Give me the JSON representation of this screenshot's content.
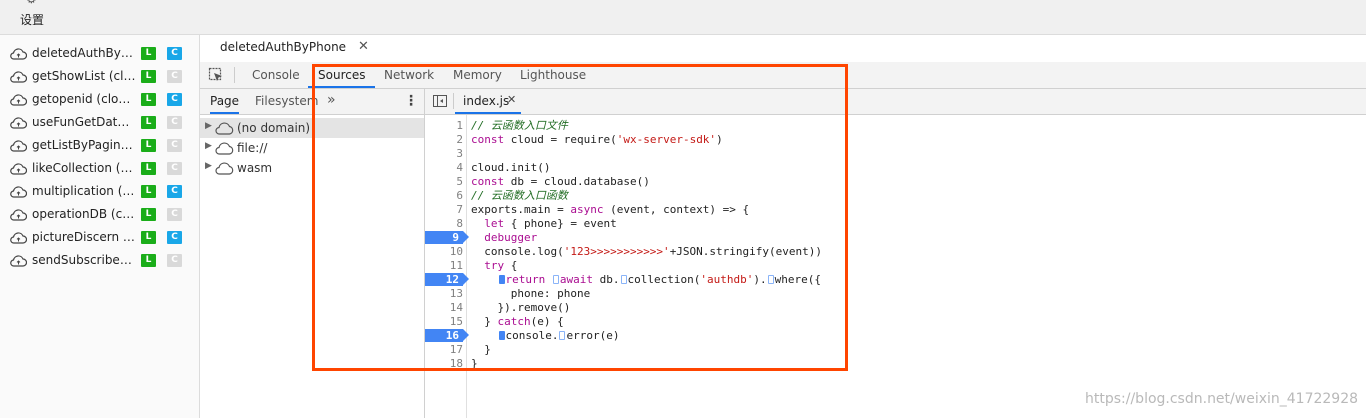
{
  "toolbar": {
    "settings_label": "设置",
    "settings_icon": "gear-icon"
  },
  "cloud_functions": [
    {
      "label": "deletedAuthByP...",
      "l_badge": "L",
      "c_badge": "C",
      "c_active": true
    },
    {
      "label": "getShowList (clo...",
      "l_badge": "L",
      "c_badge": "C",
      "c_active": false
    },
    {
      "label": "getopenid (cloud...",
      "l_badge": "L",
      "c_badge": "C",
      "c_active": true
    },
    {
      "label": "useFunGetData ...",
      "l_badge": "L",
      "c_badge": "C",
      "c_active": false
    },
    {
      "label": "getListByPaging ...",
      "l_badge": "L",
      "c_badge": "C",
      "c_active": false
    },
    {
      "label": "likeCollection (cl...",
      "l_badge": "L",
      "c_badge": "C",
      "c_active": false
    },
    {
      "label": "multiplication (cl...",
      "l_badge": "L",
      "c_badge": "C",
      "c_active": true
    },
    {
      "label": "operationDB (clo...",
      "l_badge": "L",
      "c_badge": "C",
      "c_active": false
    },
    {
      "label": "pictureDiscern (c...",
      "l_badge": "L",
      "c_badge": "C",
      "c_active": true
    },
    {
      "label": "sendSubscribeM...",
      "l_badge": "L",
      "c_badge": "C",
      "c_active": false
    }
  ],
  "file_tab": {
    "label": "deletedAuthByPhone",
    "close": "✕"
  },
  "devtools": {
    "tabs": [
      "Console",
      "Sources",
      "Network",
      "Memory",
      "Lighthouse"
    ],
    "active_tab": "Sources"
  },
  "navigator": {
    "tabs": [
      "Page",
      "Filesystem"
    ],
    "active_tab": "Page",
    "more": "»",
    "menu": "⋮",
    "tree": [
      "(no domain)",
      "file://",
      "wasm"
    ]
  },
  "editor": {
    "tab_label": "index.js",
    "tab_close": "✕",
    "lines": [
      {
        "n": "1"
      },
      {
        "n": "2"
      },
      {
        "n": "3"
      },
      {
        "n": "4"
      },
      {
        "n": "5"
      },
      {
        "n": "6"
      },
      {
        "n": "7"
      },
      {
        "n": "8"
      },
      {
        "n": "9"
      },
      {
        "n": "10"
      },
      {
        "n": "11"
      },
      {
        "n": "12"
      },
      {
        "n": "13"
      },
      {
        "n": "14"
      },
      {
        "n": "15"
      },
      {
        "n": "16"
      },
      {
        "n": "17"
      },
      {
        "n": "18"
      }
    ],
    "breakpoint_lines": [
      9,
      12,
      16
    ],
    "code": {
      "l1": "// 云函数入口文件",
      "l2_kw": "const",
      "l2_a": " cloud = require(",
      "l2_str": "'wx-server-sdk'",
      "l2_b": ")",
      "l3": "",
      "l4": "cloud.init()",
      "l5_kw": "const",
      "l5_a": " db = cloud.database()",
      "l6": "// 云函数入口函数",
      "l7_a": "exports.main = ",
      "l7_kw": "async",
      "l7_b": " (event, context) => {",
      "l8_kw": "  let",
      "l8_a": " { phone} = event",
      "l9_kw": "  debugger",
      "l10_a": "  console.log(",
      "l10_str": "'123>>>>>>>>>>>'",
      "l10_b": "+JSON.stringify(event))",
      "l11_kw": "  try",
      "l11_a": " {",
      "l12_lead": "    ",
      "l12_kw1": "return",
      "l12_kw2": "await",
      "l12_a": " db.",
      "l12_b": "collection(",
      "l12_str": "'authdb'",
      "l12_c": ").",
      "l12_d": "where({",
      "l13": "      phone: phone",
      "l14": "    }).remove()",
      "l15_a": "  } ",
      "l15_kw": "catch",
      "l15_b": "(e) {",
      "l16_lead": "    ",
      "l16_a": "console.",
      "l16_b": "error(e)",
      "l17": "  }",
      "l18": "}"
    }
  },
  "watermark": "https://blog.csdn.net/weixin_41722928",
  "colors": {
    "highlight_border": "#ff4500",
    "breakpoint": "#4285f4",
    "badge_l": "#1aad19",
    "badge_c": "#19a7e8",
    "badge_disabled": "#d9d9d9",
    "active_tab_underline": "#1a73e8"
  }
}
